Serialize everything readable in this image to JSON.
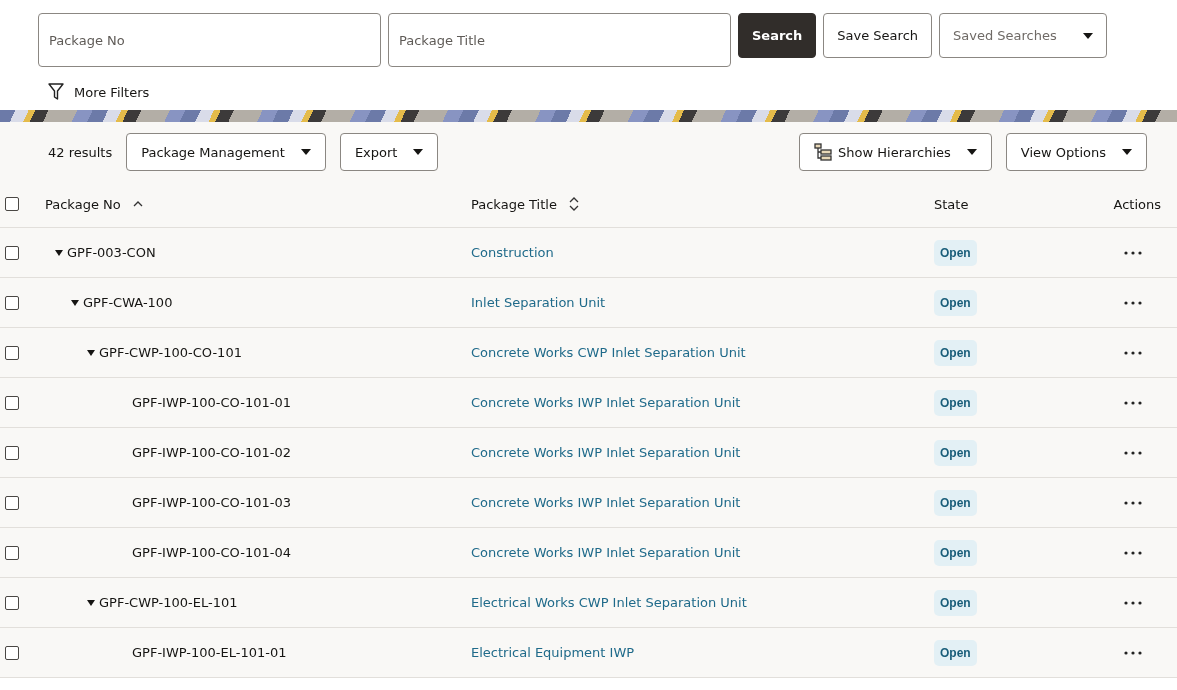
{
  "search": {
    "fields": [
      {
        "placeholder": "Package No"
      },
      {
        "placeholder": "Package Title"
      }
    ],
    "search_button": "Search",
    "save_button": "Save Search",
    "saved_searches": {
      "placeholder": "Saved Searches"
    },
    "more_filters": "More Filters"
  },
  "toolbar": {
    "results": "42 results",
    "menus": [
      "Package Management",
      "Export"
    ],
    "hierarchies": "Show Hierarchies",
    "view_options": "View Options"
  },
  "table": {
    "select_all_checked": false,
    "columns": [
      "Package No",
      "Package Title",
      "State",
      "Actions"
    ],
    "rows": [
      {
        "package_no": "GPF-003-CON",
        "title": "Construction",
        "state": "Open",
        "checked": false,
        "expanded": true,
        "children": [
          {
            "package_no": "GPF-CWA-100",
            "title": "Inlet Separation Unit",
            "state": "Open",
            "checked": false,
            "expanded": true,
            "children": [
              {
                "package_no": "GPF-CWP-100-CO-101",
                "title": "Concrete Works CWP Inlet Separation Unit",
                "state": "Open",
                "checked": false,
                "expanded": true,
                "children": [
                  {
                    "package_no": "GPF-IWP-100-CO-101-01",
                    "title": "Concrete Works IWP Inlet Separation Unit",
                    "state": "Open",
                    "checked": false
                  },
                  {
                    "package_no": "GPF-IWP-100-CO-101-02",
                    "title": "Concrete Works IWP Inlet Separation Unit",
                    "state": "Open",
                    "checked": false
                  },
                  {
                    "package_no": "GPF-IWP-100-CO-101-03",
                    "title": "Concrete Works IWP Inlet Separation Unit",
                    "state": "Open",
                    "checked": false
                  },
                  {
                    "package_no": "GPF-IWP-100-CO-101-04",
                    "title": "Concrete Works IWP Inlet Separation Unit",
                    "state": "Open",
                    "checked": false
                  }
                ]
              },
              {
                "package_no": "GPF-CWP-100-EL-101",
                "title": "Electrical Works CWP Inlet Separation Unit",
                "state": "Open",
                "checked": false,
                "expanded": true,
                "children": [
                  {
                    "package_no": "GPF-IWP-100-EL-101-01",
                    "title": "Electrical Equipment IWP",
                    "state": "Open",
                    "checked": false
                  }
                ]
              }
            ]
          }
        ]
      }
    ]
  }
}
